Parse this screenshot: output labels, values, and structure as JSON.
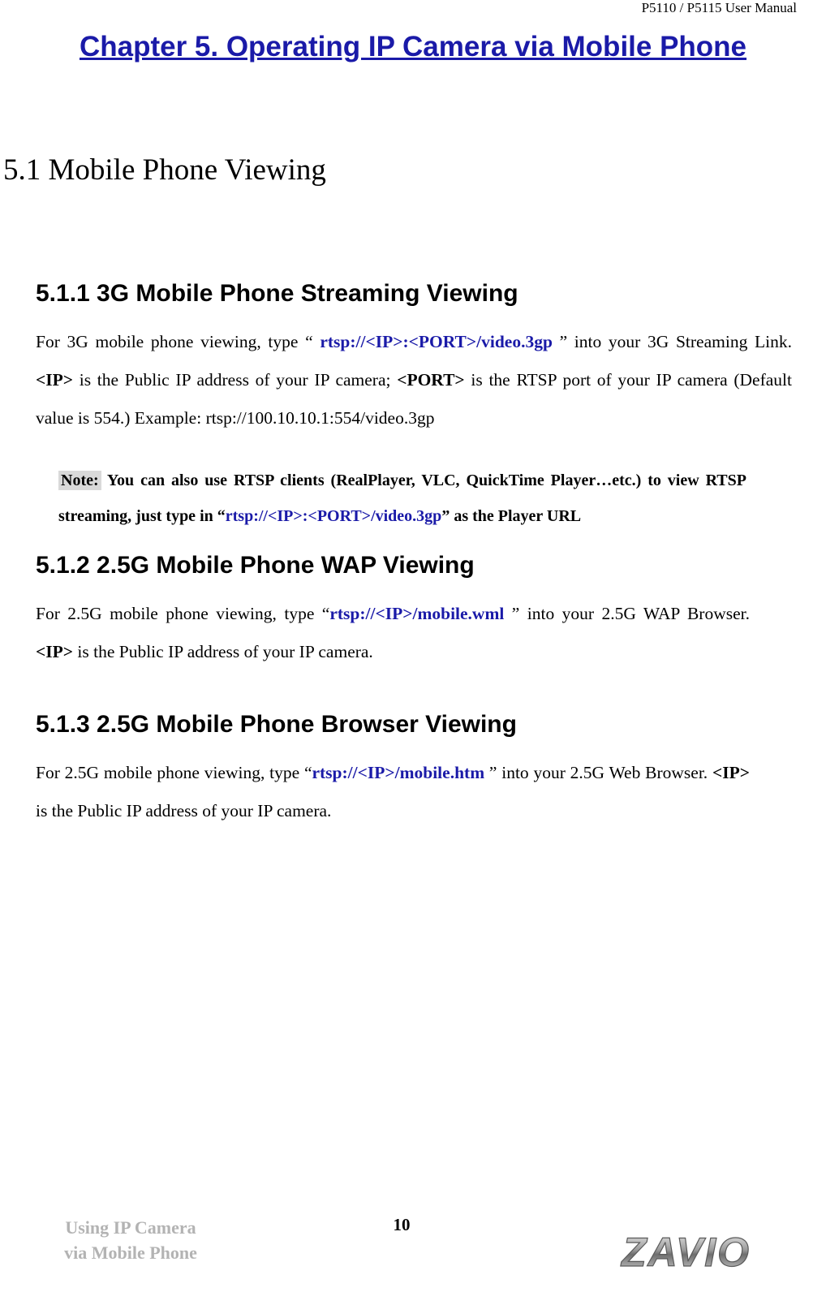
{
  "header": {
    "manual_title": "P5110 / P5115 User Manual"
  },
  "chapter": {
    "title": "Chapter 5. Operating IP Camera via Mobile Phone"
  },
  "sections": {
    "s51": {
      "heading": "5.1 Mobile Phone Viewing"
    },
    "s511": {
      "heading": "5.1.1 3G Mobile Phone Streaming Viewing",
      "text_1": "For 3G mobile phone viewing, type “ ",
      "url_1": "rtsp://<IP>:<PORT>/video.3gp",
      "text_2": " ” into your 3G Streaming Link. ",
      "bold_1": "<IP>",
      "text_3": " is the Public IP address of your IP camera; ",
      "bold_2": "<PORT>",
      "text_4": " is the RTSP port of your IP camera (Default value is 554.) Example: rtsp://100.10.10.1:554/video.3gp"
    },
    "note": {
      "label": "Note:",
      "text_1": " You can also use RTSP clients (RealPlayer, VLC, QuickTime Player…etc.) to view RTSP streaming, just type in “",
      "url": "rtsp://<IP>:<PORT>/video.3gp",
      "text_2": "” as the Player URL"
    },
    "s512": {
      "heading": "5.1.2 2.5G Mobile Phone WAP Viewing",
      "text_1": "For 2.5G mobile phone viewing, type “",
      "url": "rtsp://<IP>/mobile.wml",
      "text_2": " ” into your 2.5G WAP Browser. ",
      "bold_1": "<IP>",
      "text_3": " is the Public IP address of your IP camera."
    },
    "s513": {
      "heading": "5.1.3 2.5G Mobile Phone Browser Viewing",
      "text_1": "For 2.5G mobile phone viewing, type “",
      "url": "rtsp://<IP>/mobile.htm",
      "text_2": " ” into your 2.5G Web Browser. ",
      "bold_1": "<IP>",
      "text_3": " is the Public IP address of your IP camera."
    }
  },
  "footer": {
    "left_line1": "Using IP Camera",
    "left_line2": "via Mobile Phone",
    "page_number": "10",
    "logo_text": "ZAVIO"
  },
  "colors": {
    "link_blue": "#1a1aa8",
    "footer_gray": "#b3b3b3",
    "note_highlight": "#d9d9d9"
  }
}
